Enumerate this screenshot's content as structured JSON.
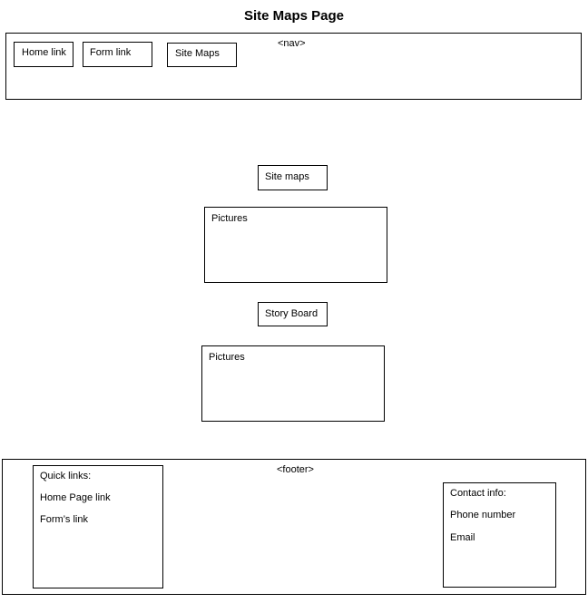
{
  "page": {
    "title": "Site Maps Page"
  },
  "nav": {
    "tag_label": "<nav>",
    "links": [
      {
        "label": "Home link"
      },
      {
        "label": "Form link"
      },
      {
        "label": "Site Maps"
      }
    ]
  },
  "main": {
    "sections": [
      {
        "heading": "Site maps",
        "content": "Pictures"
      },
      {
        "heading": "Story Board",
        "content": "Pictures"
      }
    ]
  },
  "footer": {
    "tag_label": "<footer>",
    "quick_links": {
      "heading": "Quick links:",
      "items": [
        "Home Page link",
        "Form’s link"
      ]
    },
    "contact": {
      "heading": "Contact info:",
      "items": [
        "Phone number",
        "Email"
      ]
    }
  }
}
